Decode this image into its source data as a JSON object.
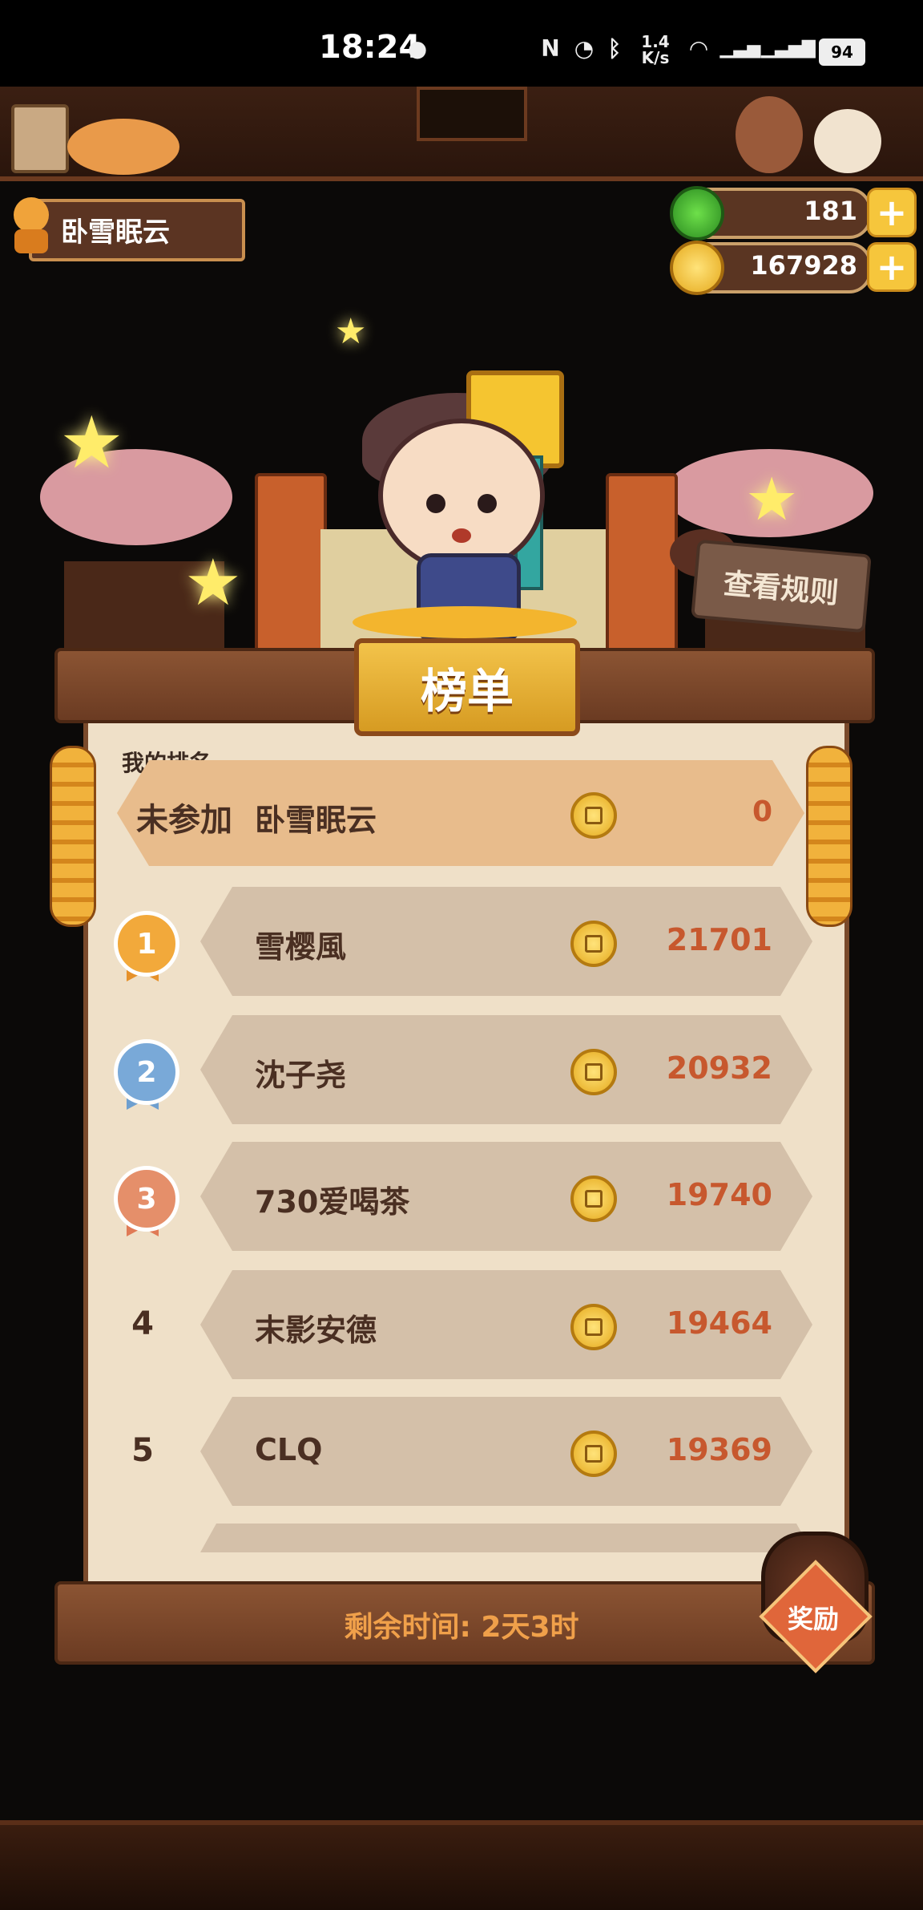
{
  "status_bar": {
    "time": "18:24",
    "net_speed_value": "1.4",
    "net_speed_unit": "K/s",
    "battery": "94",
    "icons": [
      "wechat-icon",
      "nfc-icon",
      "alarm-icon",
      "bluetooth-icon",
      "wifi-icon",
      "signal-5g-icon",
      "signal-4g-icon",
      "battery-icon"
    ]
  },
  "player": {
    "name": "卧雪眠云"
  },
  "currency": {
    "jade": "181",
    "coins": "167928",
    "plus_symbol": "+"
  },
  "rules_button": "查看规则",
  "board": {
    "title": "榜单",
    "my_rank_label": "我的排名",
    "my_row": {
      "status": "未参加",
      "name": "卧雪眠云",
      "score": "0"
    },
    "rows": [
      {
        "rank": "1",
        "name": "雪樱風",
        "score": "21701",
        "medal": "gold"
      },
      {
        "rank": "2",
        "name": "沈子尧",
        "score": "20932",
        "medal": "silver"
      },
      {
        "rank": "3",
        "name": "730爱喝茶",
        "score": "19740",
        "medal": "bronze"
      },
      {
        "rank": "4",
        "name": "末影安德",
        "score": "19464"
      },
      {
        "rank": "5",
        "name": "CLQ",
        "score": "19369"
      }
    ],
    "remaining_time": "剩余时间: 2天3时",
    "reward_label": "奖励"
  },
  "colors": {
    "gold_medal": "#f2a93b",
    "silver_medal": "#79a9d8",
    "bronze_medal": "#e58f6a",
    "score_text": "#c7582e"
  }
}
